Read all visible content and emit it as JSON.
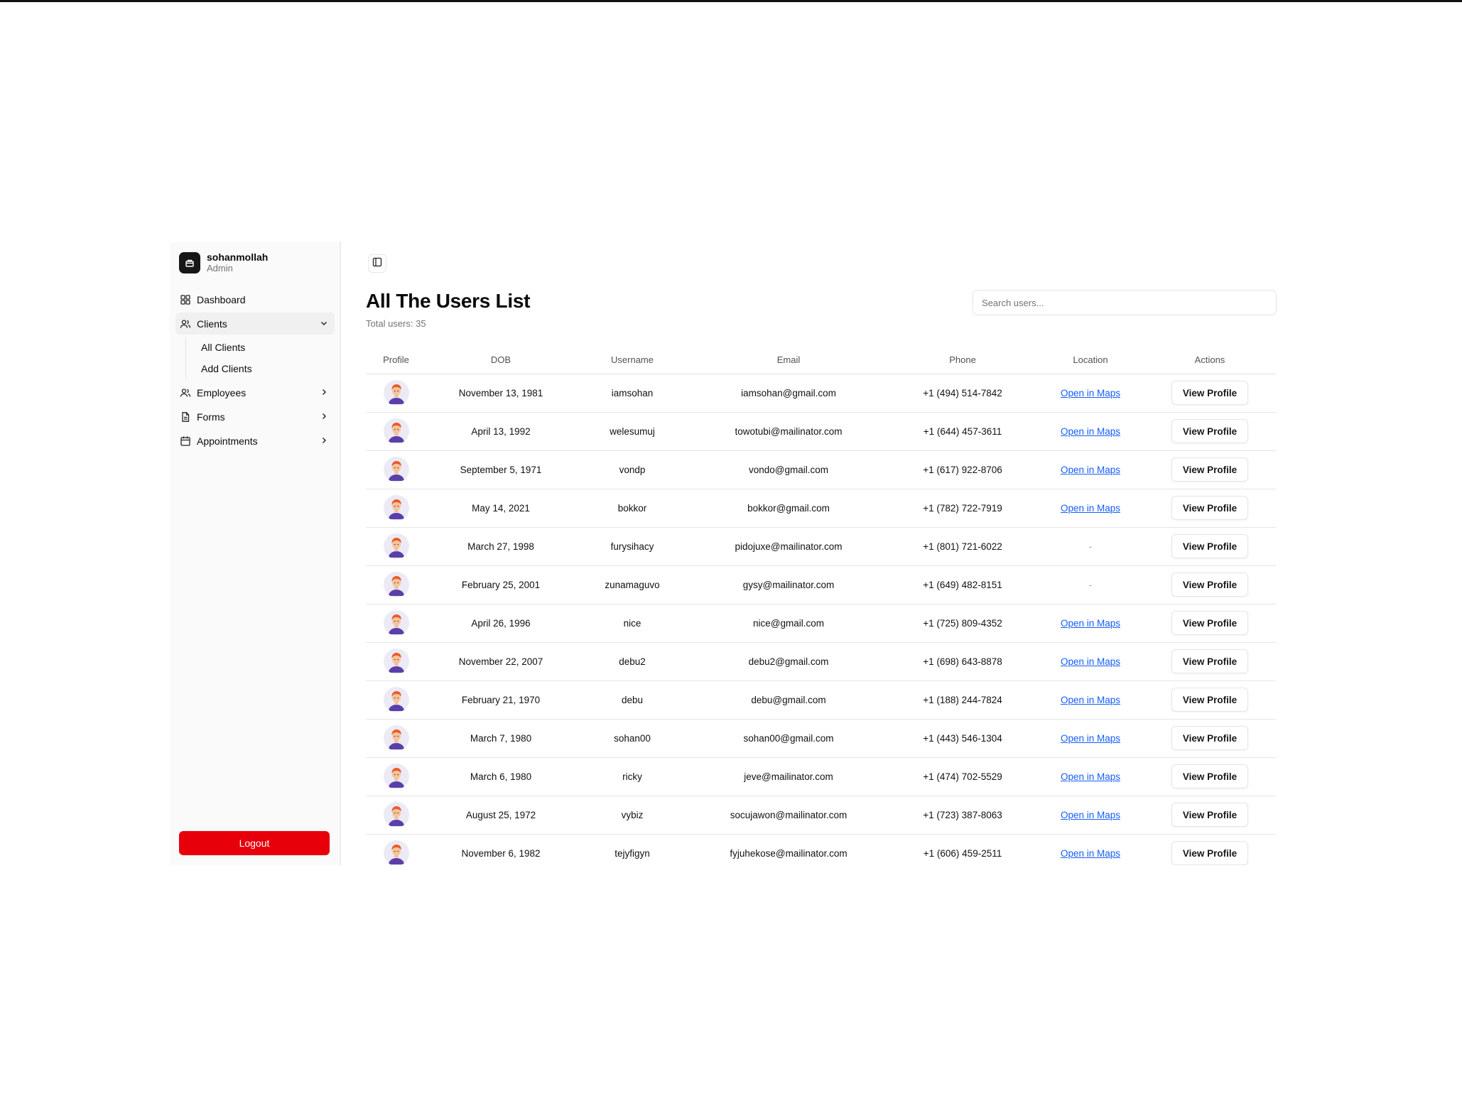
{
  "user": {
    "name": "sohanmollah",
    "role": "Admin"
  },
  "sidebar": {
    "items": [
      {
        "label": "Dashboard",
        "icon": "grid-icon"
      },
      {
        "label": "Clients",
        "icon": "users-icon",
        "expanded": true,
        "children": [
          "All Clients",
          "Add Clients"
        ]
      },
      {
        "label": "Employees",
        "icon": "users-icon"
      },
      {
        "label": "Forms",
        "icon": "file-icon"
      },
      {
        "label": "Appointments",
        "icon": "calendar-icon"
      }
    ],
    "logout_label": "Logout"
  },
  "main": {
    "title": "All The Users List",
    "total_text": "Total users: 35",
    "search_placeholder": "Search users..."
  },
  "table": {
    "headers": [
      "Profile",
      "DOB",
      "Username",
      "Email",
      "Phone",
      "Location",
      "Actions"
    ],
    "action_label": "View Profile",
    "rows": [
      {
        "dob": "November 13, 1981",
        "username": "iamsohan",
        "email": "iamsohan@gmail.com",
        "phone": "+1 (494) 514-7842",
        "location": "Open in Maps"
      },
      {
        "dob": "April 13, 1992",
        "username": "welesumuj",
        "email": "towotubi@mailinator.com",
        "phone": "+1 (644) 457-3611",
        "location": "Open in Maps"
      },
      {
        "dob": "September 5, 1971",
        "username": "vondp",
        "email": "vondo@gmail.com",
        "phone": "+1 (617) 922-8706",
        "location": "Open in Maps"
      },
      {
        "dob": "May 14, 2021",
        "username": "bokkor",
        "email": "bokkor@gmail.com",
        "phone": "+1 (782) 722-7919",
        "location": "Open in Maps"
      },
      {
        "dob": "March 27, 1998",
        "username": "furysihacy",
        "email": "pidojuxe@mailinator.com",
        "phone": "+1 (801) 721-6022",
        "location": "-"
      },
      {
        "dob": "February 25, 2001",
        "username": "zunamaguvo",
        "email": "gysy@mailinator.com",
        "phone": "+1 (649) 482-8151",
        "location": "-"
      },
      {
        "dob": "April 26, 1996",
        "username": "nice",
        "email": "nice@gmail.com",
        "phone": "+1 (725) 809-4352",
        "location": "Open in Maps"
      },
      {
        "dob": "November 22, 2007",
        "username": "debu2",
        "email": "debu2@gmail.com",
        "phone": "+1 (698) 643-8878",
        "location": "Open in Maps"
      },
      {
        "dob": "February 21, 1970",
        "username": "debu",
        "email": "debu@gmail.com",
        "phone": "+1 (188) 244-7824",
        "location": "Open in Maps"
      },
      {
        "dob": "March 7, 1980",
        "username": "sohan00",
        "email": "sohan00@gmail.com",
        "phone": "+1 (443) 546-1304",
        "location": "Open in Maps"
      },
      {
        "dob": "March 6, 1980",
        "username": "ricky",
        "email": "jeve@mailinator.com",
        "phone": "+1 (474) 702-5529",
        "location": "Open in Maps"
      },
      {
        "dob": "August 25, 1972",
        "username": "vybiz",
        "email": "socujawon@mailinator.com",
        "phone": "+1 (723) 387-8063",
        "location": "Open in Maps"
      },
      {
        "dob": "November 6, 1982",
        "username": "tejyfigyn",
        "email": "fyjuhekose@mailinator.com",
        "phone": "+1 (606) 459-2511",
        "location": "Open in Maps"
      }
    ]
  },
  "colors": {
    "logout_bg": "#e7000b",
    "link": "#155dfc",
    "avatar_bg": "#eceaf5"
  }
}
